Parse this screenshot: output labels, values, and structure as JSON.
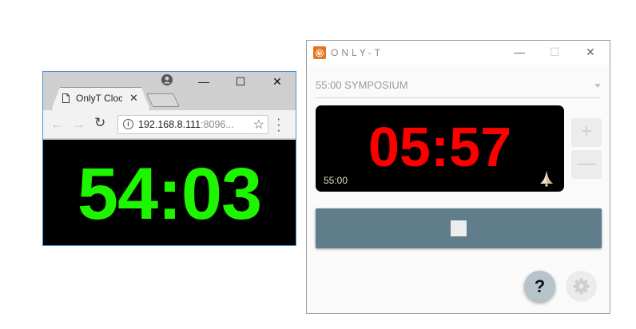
{
  "browser": {
    "tab_title": "OnlyT Clock",
    "tab_close": "✕",
    "url_host": "192.168.8.111",
    "url_rest": ":8096...",
    "clock_value": "54:03",
    "clock_color": "#1ef500",
    "window_controls": {
      "minimize": "—",
      "maximize": "☐",
      "close": "✕"
    },
    "icons": [
      "document-icon",
      "profile-icon",
      "back-arrow-icon",
      "forward-arrow-icon",
      "reload-icon",
      "info-icon",
      "star-icon",
      "menu-dots-icon"
    ]
  },
  "onlyt": {
    "app_title": "ONLY-T",
    "window_controls": {
      "minimize": "—",
      "maximize": "☐",
      "close": "✕"
    },
    "selected_talk": "55:00 SYMPOSIUM",
    "clock_value": "05:57",
    "clock_color": "#ff0000",
    "talk_duration": "55:00",
    "increment_label": "+",
    "decrement_label": "—",
    "help_label": "?",
    "accent_color": "#607d8b",
    "icons": [
      "app-logo-icon",
      "bell-icon",
      "stop-icon",
      "gear-icon"
    ]
  }
}
